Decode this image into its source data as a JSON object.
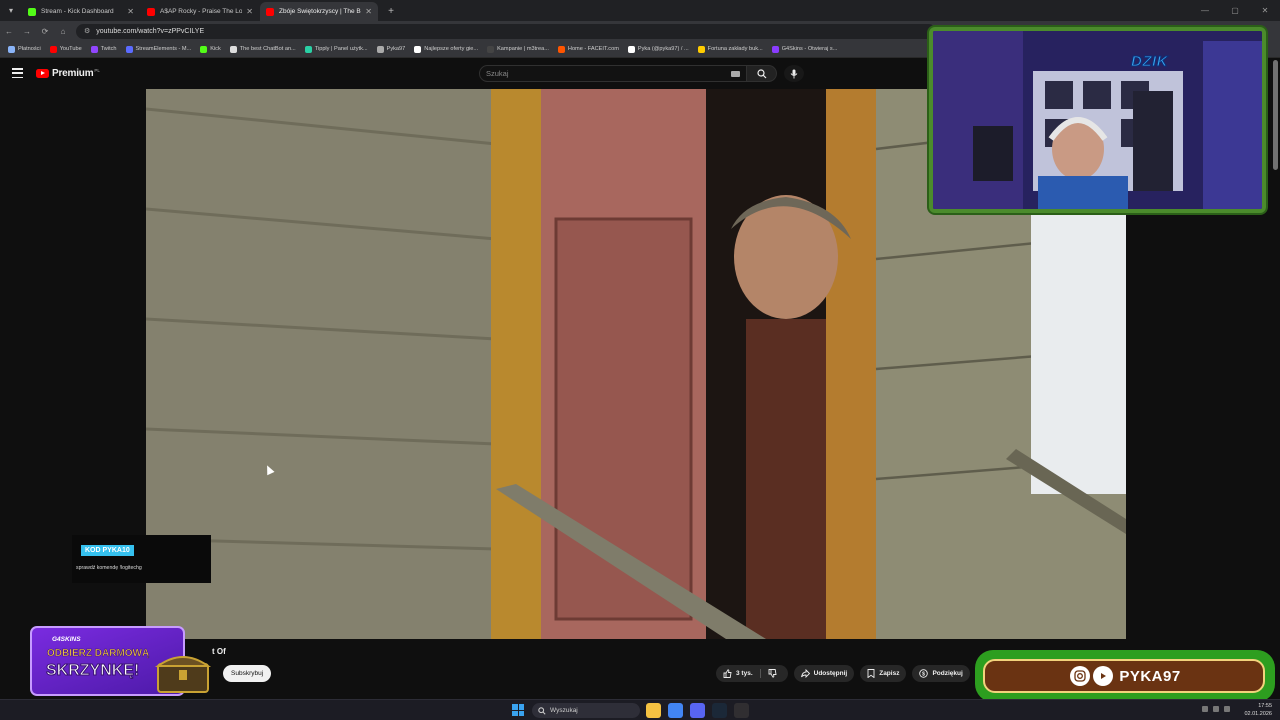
{
  "browser": {
    "tabs": [
      {
        "title": "Stream - Kick Dashboard",
        "color": "#53fc18",
        "active": false
      },
      {
        "title": "A$AP Rocky - Praise The Lord (...",
        "color": "#ff0000",
        "active": false
      },
      {
        "title": "Zbóje Świętokrzyscy | The Best...",
        "color": "#ff0000",
        "active": true
      }
    ],
    "url": "youtube.com/watch?v=zPPvCILYE",
    "bookmarks": [
      {
        "label": "Płatności",
        "color": "#8ab4f8"
      },
      {
        "label": "YouTube",
        "color": "#ff0000"
      },
      {
        "label": "Twitch",
        "color": "#9146ff"
      },
      {
        "label": "StreamElements - M...",
        "color": "#5b6bff"
      },
      {
        "label": "Kick",
        "color": "#53fc18"
      },
      {
        "label": "The best ChatBot an...",
        "color": "#dddddd"
      },
      {
        "label": "Tipply | Panel użytk...",
        "color": "#2ad0a5"
      },
      {
        "label": "Pyka97",
        "color": "#aaaaaa"
      },
      {
        "label": "Najlepsze oferty gie...",
        "color": "#ffffff"
      },
      {
        "label": "Kampanie | m3trea...",
        "color": "#444444"
      },
      {
        "label": "Home - FACEIT.com",
        "color": "#ff5500"
      },
      {
        "label": "Pyka (@pyka97) / ...",
        "color": "#ffffff"
      },
      {
        "label": "Fortuna zakłady buk...",
        "color": "#ffcc00"
      },
      {
        "label": "G4Skins - Otwieraj s...",
        "color": "#8a3cff"
      }
    ]
  },
  "youtube": {
    "logo_text": "Premium",
    "logo_region": "PL",
    "search_placeholder": "Szukaj",
    "title_fragment": "t Of",
    "subscribe_label": "Subskrybuj",
    "likes": "3 tys.",
    "share_label": "Udostępnij",
    "save_label": "Zapisz",
    "thanks_label": "Podziękuj"
  },
  "overlay": {
    "sponsor_code": "KOD PYKA10",
    "sponsor_note": "sprawdź komendę !logitechg",
    "promo_brand": "G4SKINS",
    "promo_line1": "ODBIERZ DARMOWĄ",
    "promo_line2": "SKRZYNKĘ!",
    "webcam_brand": "DZIK",
    "social_handle": "PYKA97"
  },
  "taskbar": {
    "search_label": "Wyszukaj",
    "time": "17:55",
    "date": "02.01.2026",
    "apps": [
      {
        "name": "file-explorer",
        "color": "#f5c242"
      },
      {
        "name": "chrome",
        "color": "#4285f4"
      },
      {
        "name": "discord",
        "color": "#5865f2"
      },
      {
        "name": "steam",
        "color": "#1b2838"
      },
      {
        "name": "obs",
        "color": "#302e31"
      }
    ]
  }
}
